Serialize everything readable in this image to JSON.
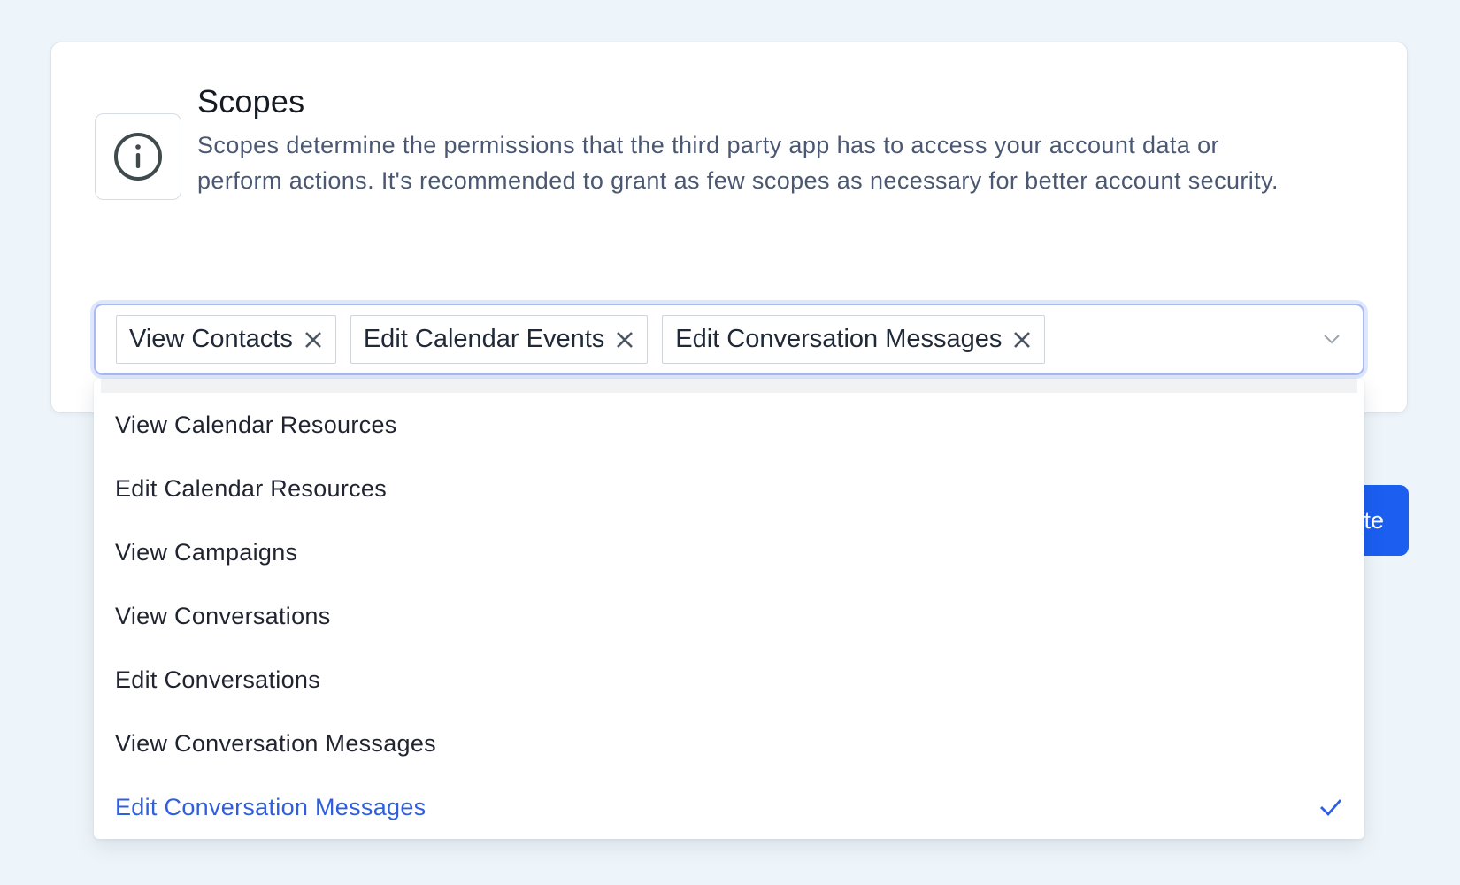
{
  "scopes": {
    "title": "Scopes",
    "description": "Scopes determine the permissions that the third party app has to access your account data or perform actions. It's recommended to grant as few scopes as necessary for better account security.",
    "info_icon": "info-circle-icon"
  },
  "selected_tags": [
    {
      "label": "View Contacts"
    },
    {
      "label": "Edit Calendar Events"
    },
    {
      "label": "Edit Conversation Messages"
    }
  ],
  "dropdown": {
    "options": [
      {
        "label": "View Calendar Resources",
        "selected": false
      },
      {
        "label": "Edit Calendar Resources",
        "selected": false
      },
      {
        "label": "View Campaigns",
        "selected": false
      },
      {
        "label": "View Conversations",
        "selected": false
      },
      {
        "label": "Edit Conversations",
        "selected": false
      },
      {
        "label": "View Conversation Messages",
        "selected": false
      },
      {
        "label": "Edit Conversation Messages",
        "selected": true
      }
    ]
  },
  "partial_button": {
    "label": "te"
  },
  "colors": {
    "accent": "#1b5ef0",
    "selected_option": "#2f5fe0",
    "focus_ring": "#a8b9f4"
  }
}
